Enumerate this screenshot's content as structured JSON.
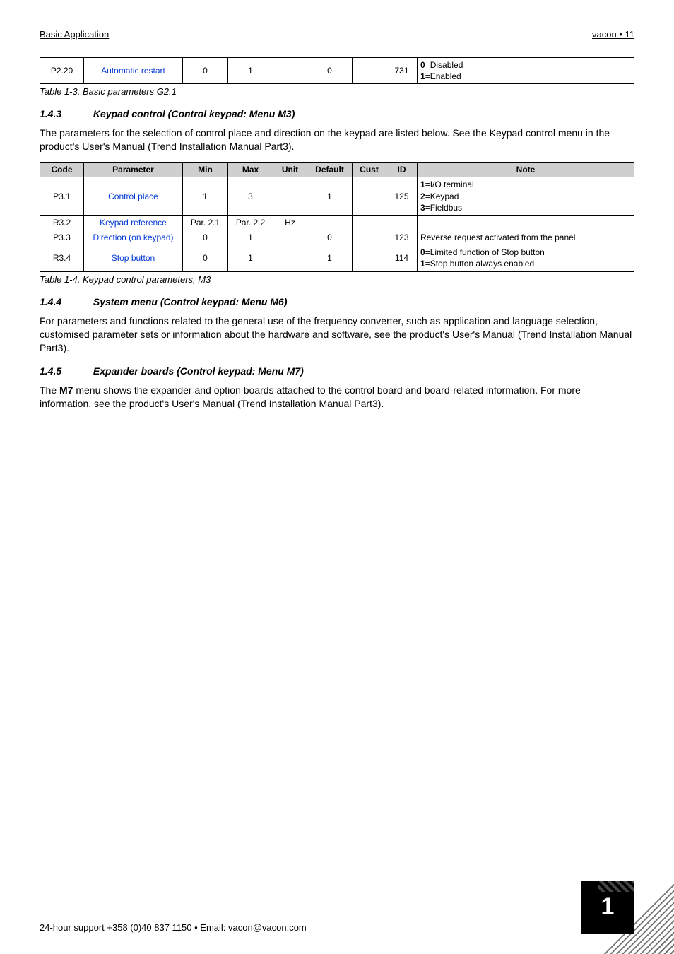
{
  "header": {
    "left": "Basic Application",
    "right": "vacon • 11"
  },
  "table1": {
    "row": {
      "code": "P2.20",
      "parameter": "Automatic restart",
      "min": "0",
      "max": "1",
      "unit": "",
      "default": "0",
      "cust": "",
      "id": "731",
      "note": "0=Disabled\n1=Enabled"
    },
    "caption": "Table 1-3. Basic parameters G2.1"
  },
  "sec143": {
    "num": "1.4.3",
    "title": "Keypad control (Control keypad: Menu M3)",
    "body": "The parameters for the selection of control place and direction on the keypad are listed below. See the Keypad control menu in the product's User's Manual (Trend Installation Manual Part3)."
  },
  "table2": {
    "headers": {
      "code": "Code",
      "parameter": "Parameter",
      "min": "Min",
      "max": "Max",
      "unit": "Unit",
      "default": "Default",
      "cust": "Cust",
      "id": "ID",
      "note": "Note"
    },
    "rows": [
      {
        "code": "P3.1",
        "parameter": "Control place",
        "min": "1",
        "max": "3",
        "unit": "",
        "default": "1",
        "cust": "",
        "id": "125",
        "note": "1=I/O terminal\n2=Keypad\n3=Fieldbus"
      },
      {
        "code": "R3.2",
        "parameter": "Keypad reference",
        "min": "Par. 2.1",
        "max": "Par. 2.2",
        "unit": "Hz",
        "default": "",
        "cust": "",
        "id": "",
        "note": ""
      },
      {
        "code": "P3.3",
        "parameter": "Direction (on keypad)",
        "min": "0",
        "max": "1",
        "unit": "",
        "default": "0",
        "cust": "",
        "id": "123",
        "note": "Reverse request activated from the panel"
      },
      {
        "code": "R3.4",
        "parameter": "Stop button",
        "min": "0",
        "max": "1",
        "unit": "",
        "default": "1",
        "cust": "",
        "id": "114",
        "note": "0=Limited function of Stop button\n1=Stop button always enabled"
      }
    ],
    "caption": "Table 1-4. Keypad control parameters, M3"
  },
  "sec144": {
    "num": "1.4.4",
    "title": "System menu (Control keypad: Menu M6)",
    "body": "For parameters and functions related to the general use of the frequency converter, such as application and language selection, customised parameter sets or information about the hardware and software, see the product's User's Manual (Trend Installation Manual Part3)."
  },
  "sec145": {
    "num": "1.4.5",
    "title": "Expander boards (Control keypad: Menu M7)",
    "body_pre": "The ",
    "body_bold": "M7",
    "body_post": " menu shows the expander and option boards attached to the control board and board-related information. For more information, see the product's User's Manual (Trend Installation Manual Part3)."
  },
  "footer": {
    "text": "24-hour support +358 (0)40 837 1150 • Email: vacon@vacon.com",
    "page": "1"
  }
}
